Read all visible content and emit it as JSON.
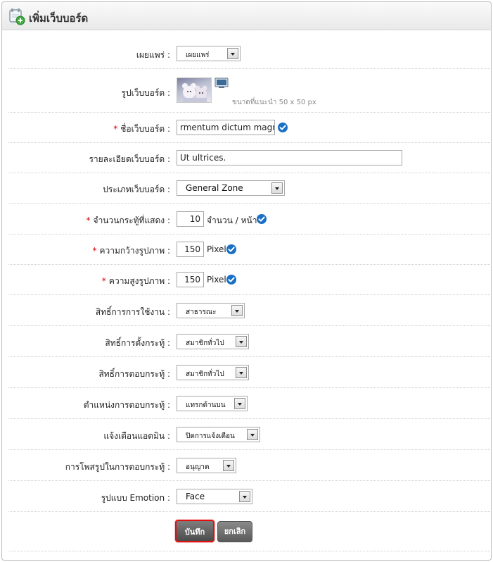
{
  "header": {
    "title": "เพิ่มเว็บบอร์ด",
    "icon": "add-webboard-icon"
  },
  "fields": {
    "publish": {
      "label": "เผยแพร่ :",
      "value": "เผยแพร่"
    },
    "image": {
      "label": "รูปเว็บบอร์ด :",
      "hint": "ขนาดที่แนะนำ 50 x 50 px"
    },
    "name": {
      "label": "ชื่อเว็บบอร์ด :",
      "required": "*",
      "value": "rmentum dictum magna."
    },
    "description": {
      "label": "รายละเอียดเว็บบอร์ด :",
      "value": "Ut ultrices."
    },
    "type": {
      "label": "ประเภทเว็บบอร์ด :",
      "value": "General Zone"
    },
    "topics_shown": {
      "label": "จำนวนกระทู้ที่แสดง :",
      "required": "*",
      "value": "10",
      "unit": "จำนวน / หน้า"
    },
    "image_width": {
      "label": "ความกว้างรูปภาพ :",
      "required": "*",
      "value": "150",
      "unit": "Pixel"
    },
    "image_height": {
      "label": "ความสูงรูปภาพ :",
      "required": "*",
      "value": "150",
      "unit": "Pixel"
    },
    "usage_rights": {
      "label": "สิทธิ์การการใช้งาน :",
      "value": "สาธารณะ"
    },
    "post_rights": {
      "label": "สิทธิ์การตั้งกระทู้ :",
      "value": "สมาชิกทั่วไป"
    },
    "reply_rights": {
      "label": "สิทธิ์การตอบกระทู้ :",
      "value": "สมาชิกทั่วไป"
    },
    "reply_position": {
      "label": "ตำแหน่งการตอบกระทู้ :",
      "value": "แทรกด้านบน"
    },
    "admin_notify": {
      "label": "แจ้งเตือนแอดมิน :",
      "value": "ปิดการแจ้งเตือน"
    },
    "reply_images": {
      "label": "การโพสรูปในการตอบกระทู้ :",
      "value": "อนุญาต"
    },
    "emotion": {
      "label": "รูปแบบ Emotion :",
      "value": "Face"
    }
  },
  "buttons": {
    "save": "บันทึก",
    "cancel": "ยกเลิก"
  },
  "colors": {
    "required": "#d00000",
    "check": "#1a6fc7",
    "save_border": "#e01010"
  }
}
